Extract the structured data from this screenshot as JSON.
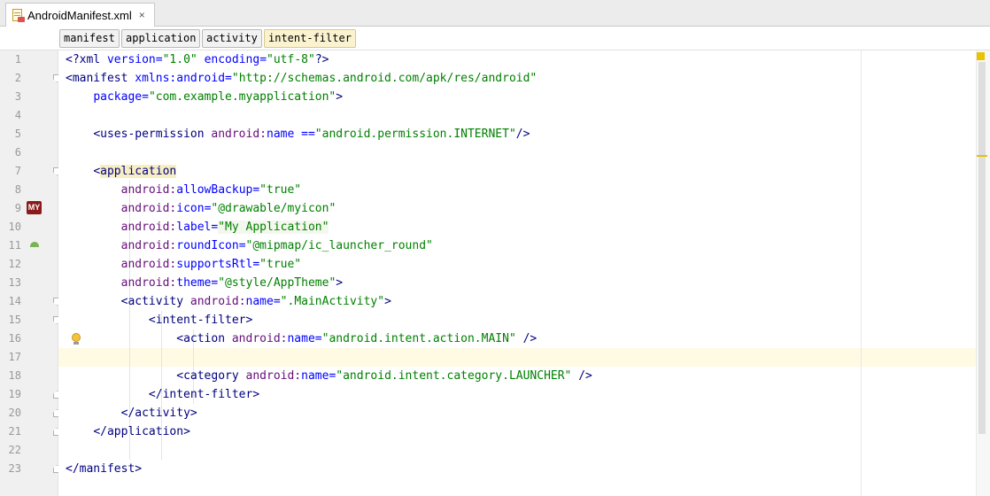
{
  "tab": {
    "filename": "AndroidManifest.xml",
    "icon": "xml-file-icon",
    "close": "×"
  },
  "breadcrumbs": [
    "manifest",
    "application",
    "activity",
    "intent-filter"
  ],
  "line_numbers": [
    "1",
    "2",
    "3",
    "4",
    "5",
    "6",
    "7",
    "8",
    "9",
    "10",
    "11",
    "12",
    "13",
    "14",
    "15",
    "16",
    "17",
    "18",
    "19",
    "20",
    "21",
    "22",
    "23"
  ],
  "code": {
    "l1": {
      "open": "<?",
      "tag": "xml",
      "a1": "version",
      "v1": "\"1.0\"",
      "a2": "encoding",
      "v2": "\"utf-8\"",
      "close": "?>"
    },
    "l2": {
      "open": "<",
      "tag": "manifest",
      "ns": "xmlns:",
      "an": "android",
      "v": "\"http://schemas.android.com/apk/res/android\""
    },
    "l3": {
      "a": "package",
      "v": "\"com.example.myapplication\"",
      "close": ">"
    },
    "l5": {
      "open": "<",
      "tag": "uses-permission",
      "ns": "android:",
      "an": "name",
      "eq": " =",
      "v": "\"android.permission.INTERNET\"",
      "close": "/>"
    },
    "l7": {
      "open": "<",
      "tag": "application"
    },
    "l8": {
      "ns": "android:",
      "an": "allowBackup",
      "v": "\"true\""
    },
    "l9": {
      "ns": "android:",
      "an": "icon",
      "v": "\"@drawable/myicon\""
    },
    "l10": {
      "ns": "android:",
      "an": "label",
      "v": "\"My Application\""
    },
    "l11": {
      "ns": "android:",
      "an": "roundIcon",
      "v": "\"@mipmap/ic_launcher_round\""
    },
    "l12": {
      "ns": "android:",
      "an": "supportsRtl",
      "v": "\"true\""
    },
    "l13": {
      "ns": "android:",
      "an": "theme",
      "v": "\"@style/AppTheme\"",
      "close": ">"
    },
    "l14": {
      "open": "<",
      "tag": "activity",
      "ns": "android:",
      "an": "name",
      "v": "\".MainActivity\"",
      "close": ">"
    },
    "l15": {
      "open": "<",
      "tag": "intent-filter",
      "close": ">"
    },
    "l16": {
      "open": "<",
      "tag": "action",
      "ns": "android:",
      "an": "name",
      "v": "\"android.intent.action.MAIN\"",
      "close": "/>"
    },
    "l18": {
      "open": "<",
      "tag": "category",
      "ns": "android:",
      "an": "name",
      "v": "\"android.intent.category.LAUNCHER\"",
      "close": "/>"
    },
    "l19": {
      "open": "</",
      "tag": "intent-filter",
      "close": ">"
    },
    "l20": {
      "open": "</",
      "tag": "activity",
      "close": ">"
    },
    "l21": {
      "open": "</",
      "tag": "application",
      "close": ">"
    },
    "l23": {
      "open": "</",
      "tag": "manifest",
      "close": ">"
    }
  },
  "gutter_icons": {
    "my_badge": "MY"
  },
  "colors": {
    "tag": "#000080",
    "namespace": "#660e7a",
    "attribute": "#0000ff",
    "value": "#008000",
    "caret_line": "#fffae3"
  }
}
